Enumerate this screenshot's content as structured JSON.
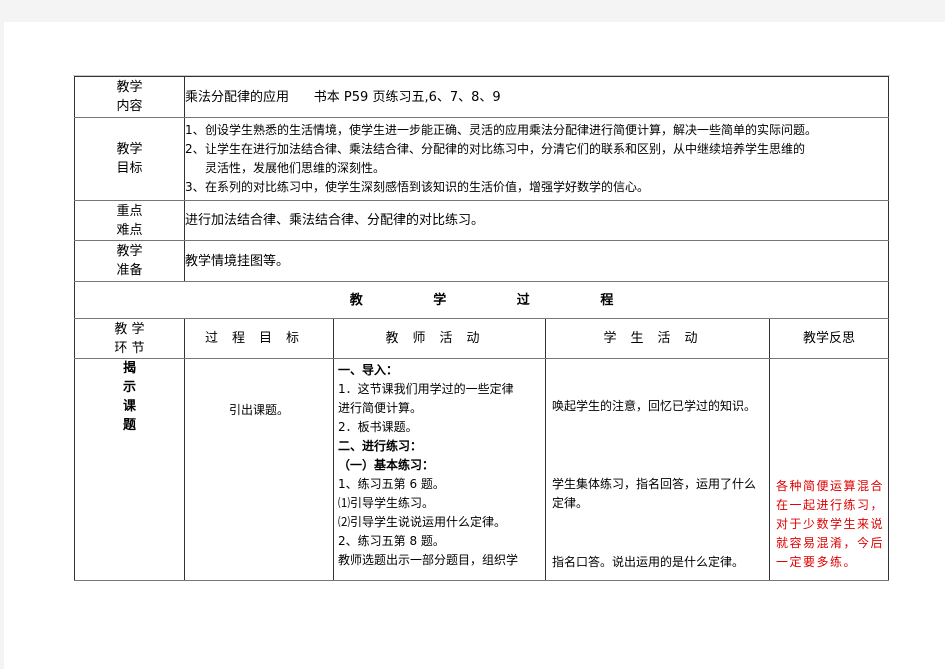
{
  "rows": {
    "content": {
      "label": [
        "教学",
        "内容"
      ],
      "text": "乘法分配律的应用      书本 P59 页练习五,6、7、8、9"
    },
    "goals": {
      "label": [
        "教学",
        "目标"
      ],
      "items": [
        {
          "num": "1、",
          "lines": [
            "创设学生熟悉的生活情境，使学生进一步能正确、灵活的应用乘法分配律进行简便计算，解决一些简单的实际问题。"
          ]
        },
        {
          "num": "2、",
          "lines": [
            "让学生在进行加法结合律、乘法结合律、分配律的对比练习中，分清它们的联系和区别，从中继续培养学生思维的",
            "灵活性，发展他们思维的深刻性。"
          ]
        },
        {
          "num": "3、",
          "lines": [
            "在系列的对比练习中，使学生深刻感悟到该知识的生活价值，增强学好数学的信心。"
          ]
        }
      ]
    },
    "key_points": {
      "label": [
        "重点",
        "难点"
      ],
      "text": "进行加法结合律、乘法结合律、分配律的对比练习。"
    },
    "preparation": {
      "label": [
        "教学",
        "准备"
      ],
      "text": "教学情境挂图等。"
    }
  },
  "process": {
    "title": [
      "教",
      "学",
      "过",
      "程"
    ],
    "headers": {
      "stage": [
        "教 学",
        "环 节"
      ],
      "goal": "过程目标",
      "teacher": "教师活动",
      "student": "学生活动",
      "reflection": "教学反思"
    },
    "row": {
      "stage": [
        "揭",
        "示",
        "课",
        "题"
      ],
      "goal": "引出课题。",
      "teacher": [
        {
          "text": "一、导入：",
          "bold": true
        },
        {
          "text": "1．这节课我们用学过的一些定律",
          "bold": false
        },
        {
          "text": "进行简便计算。",
          "bold": false
        },
        {
          "text": "2．板书课题。",
          "bold": false
        },
        {
          "text": "二、进行练习：",
          "bold": true
        },
        {
          "text": "（一）基本练习：",
          "bold": true
        },
        {
          "text": "1、练习五第 6 题。",
          "bold": false
        },
        {
          "text": "⑴引导学生练习。",
          "bold": false
        },
        {
          "text": "⑵引导学生说说运用什么定律。",
          "bold": false
        },
        {
          "text": "2、练习五第 8 题。",
          "bold": false
        },
        {
          "text": "教师选题出示一部分题目，组织学",
          "bold": false
        }
      ],
      "student": [
        "唤起学生的注意，回忆已学过的知识。",
        "学生集体练习，指名回答，运用了什么定律。",
        "指名口答。说出运用的是什么定律。"
      ],
      "reflection": "各种简便运算混合在一起进行练习，对于少数学生来说就容易混淆，今后一定要多练。"
    }
  },
  "colors": {
    "reflection_text": "#e00000",
    "border": "#333333",
    "page_background": "#f4f4f4"
  }
}
